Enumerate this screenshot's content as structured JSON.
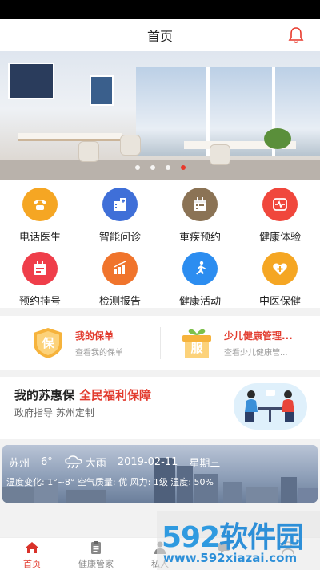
{
  "nav": {
    "title": "首页",
    "bell_icon": "bell-icon"
  },
  "banner": {
    "dots": 4,
    "active_dot": 3
  },
  "grid": [
    {
      "label": "电话医生",
      "icon": "phone-icon",
      "color": "#f5a623"
    },
    {
      "label": "智能问诊",
      "icon": "hospital-icon",
      "color": "#3f6fd8"
    },
    {
      "label": "重疾预约",
      "icon": "calendar-icon",
      "color": "#8b7355"
    },
    {
      "label": "健康体验",
      "icon": "heart-pulse-icon",
      "color": "#f0473c"
    },
    {
      "label": "预约挂号",
      "icon": "registration-icon",
      "color": "#ef3e4a"
    },
    {
      "label": "检测报告",
      "icon": "report-chart-icon",
      "color": "#f0742c"
    },
    {
      "label": "健康活动",
      "icon": "running-icon",
      "color": "#2c8df0"
    },
    {
      "label": "中医保健",
      "icon": "heart-plus-icon",
      "color": "#f5a623"
    }
  ],
  "policy": {
    "left": {
      "badge": "保",
      "title": "我的保单",
      "subtitle": "查看我的保单"
    },
    "right": {
      "badge": "服",
      "title": "少儿健康管理...",
      "subtitle": "查看少儿健康管..."
    }
  },
  "suhuibao": {
    "title": "我的苏惠保",
    "highlight": "全民福利保障",
    "subtitle": "政府指导 苏州定制"
  },
  "weather": {
    "city": "苏州",
    "temp": "6°",
    "condition": "大雨",
    "date": "2019-02-11",
    "weekday": "星期三",
    "details": "温度变化: 1°~8° 空气质量: 优 风力: 1级 湿度: 50%"
  },
  "tabs": [
    {
      "label": "首页",
      "icon": "home-icon",
      "active": true
    },
    {
      "label": "健康管家",
      "icon": "clipboard-icon",
      "active": false
    },
    {
      "label": "私人",
      "icon": "person-icon",
      "active": false
    },
    {
      "label": "",
      "icon": "chat-icon",
      "active": false
    },
    {
      "label": "",
      "icon": "user-icon",
      "active": false
    }
  ],
  "watermark": {
    "logo_num": "592",
    "logo_cn": "软件园",
    "url": "www.592xiazai.com"
  },
  "colors": {
    "accent": "#e23b2e",
    "active_dot": "#e8392b"
  }
}
